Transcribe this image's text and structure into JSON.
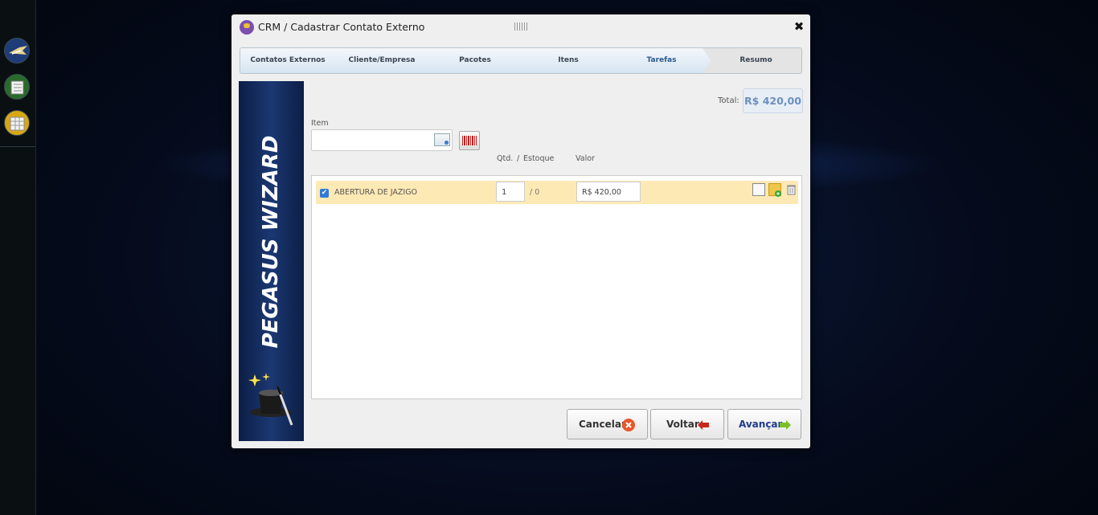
{
  "sidebar": {
    "items": [
      {
        "icon": "pegasus-icon"
      },
      {
        "icon": "list-icon"
      },
      {
        "icon": "grid-icon"
      }
    ]
  },
  "dialog": {
    "title": "CRM / Cadastrar Contato Externo",
    "close_icon": "close-icon"
  },
  "wizard": {
    "steps": [
      {
        "label": "Contatos Externos"
      },
      {
        "label": "Cliente/Empresa"
      },
      {
        "label": "Pacotes"
      },
      {
        "label": "Itens"
      },
      {
        "label": "Tarefas"
      },
      {
        "label": "Resumo"
      }
    ],
    "banner_text": "PEGASUS WIZARD"
  },
  "summary": {
    "total_label": "Total:",
    "total_value": "R$ 420,00"
  },
  "item_field": {
    "label": "Item",
    "value": "",
    "placeholder": ""
  },
  "columns": {
    "qty": "Qtd.",
    "separator": "/",
    "stock": "Estoque",
    "value": "Valor"
  },
  "items": [
    {
      "checked": true,
      "name": "ABERTURA DE JAZIGO",
      "qty": "1",
      "stock": "/ 0",
      "value": "R$ 420,00"
    }
  ],
  "buttons": {
    "cancel": "Cancelar",
    "back": "Voltar",
    "next": "Avançar"
  },
  "colors": {
    "accent": "#2f7ad6",
    "row_highlight": "#fde9b4",
    "total": "#6a90c0"
  }
}
